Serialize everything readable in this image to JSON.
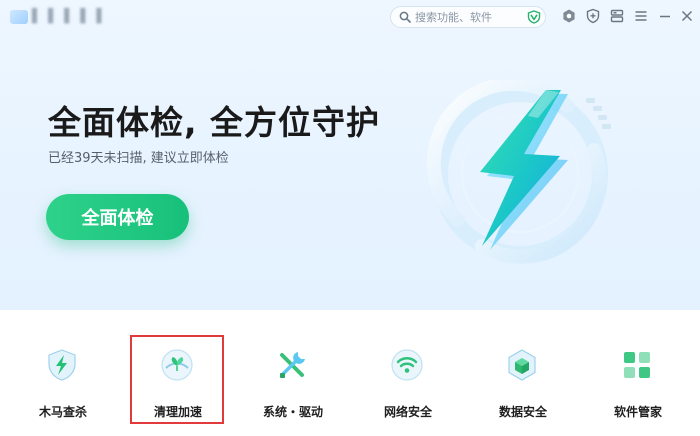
{
  "app": {
    "title": "▌ ▌ ▌ ▌ ▌"
  },
  "search": {
    "placeholder": "搜索功能、软件"
  },
  "titlebar": {
    "icons": [
      "settings-hex-icon",
      "shield-plus-icon",
      "skin-icon",
      "menu-icon",
      "minimize-icon",
      "close-icon"
    ]
  },
  "hero": {
    "title": "全面体检, 全方位守护",
    "subtitle": "已经39天未扫描, 建议立即体检",
    "button": "全面体检"
  },
  "tools": [
    {
      "label": "木马查杀",
      "icon": "trojan-shield-icon"
    },
    {
      "label": "清理加速",
      "icon": "cleanup-accelerate-icon"
    },
    {
      "label": "系统・驱动",
      "icon": "system-driver-tools-icon"
    },
    {
      "label": "网络安全",
      "icon": "wifi-security-icon"
    },
    {
      "label": "数据安全",
      "icon": "data-cube-icon"
    },
    {
      "label": "软件管家",
      "icon": "software-manager-icon"
    }
  ],
  "colors": {
    "accent_green": "#17c07a",
    "highlight": "#e23a3a",
    "hero_bg": "#e7f3ff"
  }
}
